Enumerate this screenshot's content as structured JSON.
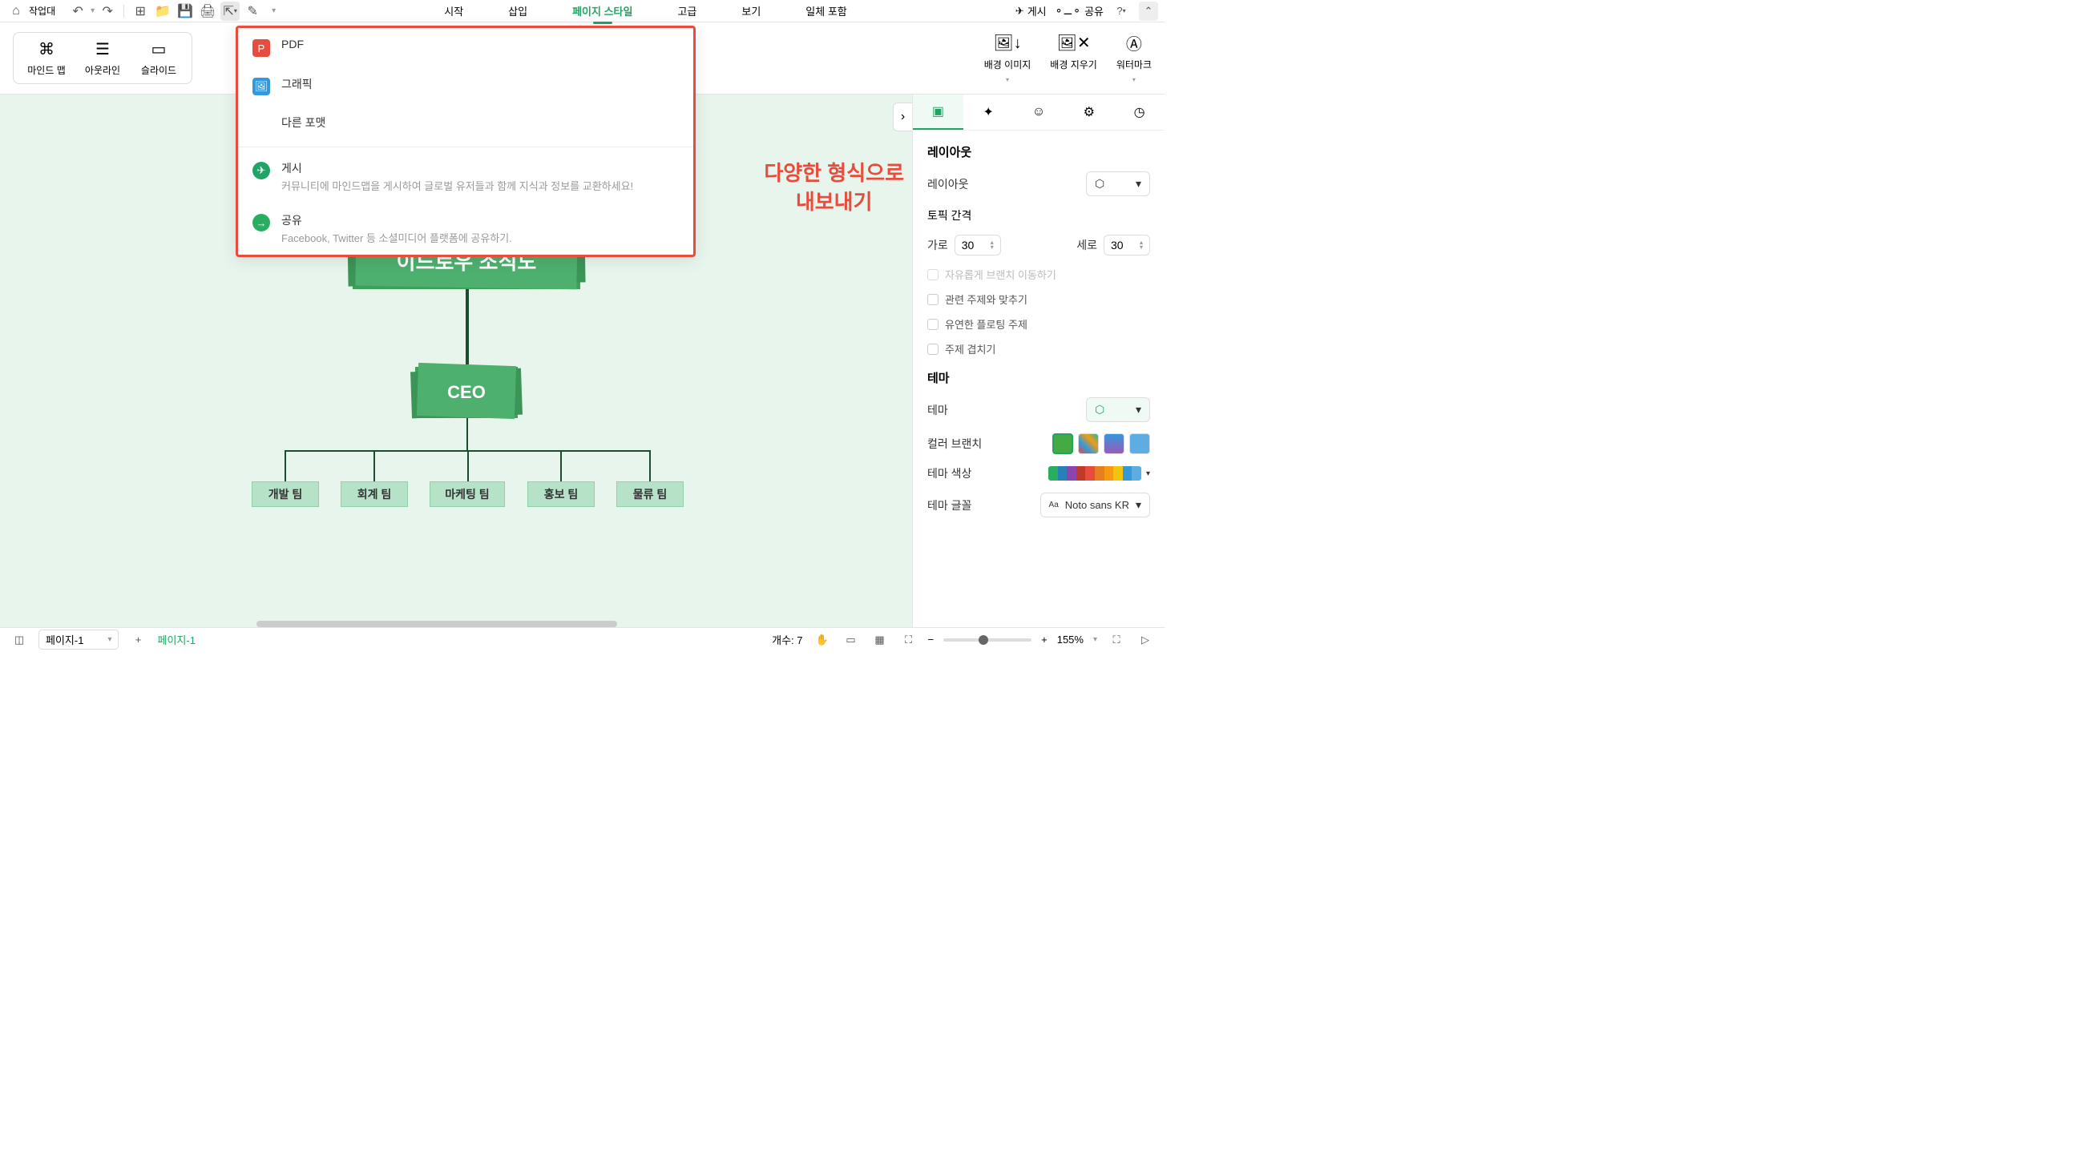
{
  "toolbar": {
    "workspace": "작업대",
    "tabs": [
      "시작",
      "삽입",
      "페이지 스타일",
      "고급",
      "보기",
      "일체 포함"
    ],
    "active_tab": 2,
    "publish": "게시",
    "share": "공유"
  },
  "ribbon": {
    "views": [
      {
        "label": "마인드 맵"
      },
      {
        "label": "아웃라인"
      },
      {
        "label": "슬라이드"
      }
    ],
    "right": [
      {
        "label": "배경 이미지"
      },
      {
        "label": "배경 지우기"
      },
      {
        "label": "워터마크"
      }
    ]
  },
  "export_menu": {
    "items": [
      {
        "title": "PDF",
        "icon": "pdf"
      },
      {
        "title": "그래픽",
        "icon": "img"
      },
      {
        "title": "다른 포맷",
        "icon": ""
      }
    ],
    "actions": [
      {
        "title": "게시",
        "desc": "커뮤니티에 마인드맵을 게시하여 글로벌 유저들과 함께 지식과 정보를 교환하세요!",
        "icon": "pub"
      },
      {
        "title": "공유",
        "desc": "Facebook, Twitter 등 소셜미디어 플랫폼에 공유하기.",
        "icon": "share"
      }
    ]
  },
  "annotation": {
    "line1": "다양한 형식으로",
    "line2": "내보내기"
  },
  "chart": {
    "root": "이드로우 조직도",
    "ceo": "CEO",
    "teams": [
      "개발 팀",
      "회계 팀",
      "마케팅 팀",
      "홍보 팀",
      "물류 팀"
    ]
  },
  "panel": {
    "section_layout": "레이아웃",
    "layout_label": "레이아웃",
    "topic_spacing": "토픽 간격",
    "horiz": "가로",
    "horiz_val": "30",
    "vert": "세로",
    "vert_val": "30",
    "cb_free": "자유롭게 브랜치 이동하기",
    "cb_align": "관련 주제와 맞추기",
    "cb_flex": "유연한 플로팅 주제",
    "cb_overlap": "주제 겹치기",
    "section_theme": "테마",
    "theme_label": "테마",
    "color_branch": "컬러 브랜치",
    "theme_color": "테마 색상",
    "theme_font": "테마 글꼴",
    "font_val": "Noto sans KR"
  },
  "bottom": {
    "page_sel": "페이지-1",
    "page_tab": "페이지-1",
    "count_label": "개수:",
    "count": "7",
    "zoom": "155%"
  }
}
